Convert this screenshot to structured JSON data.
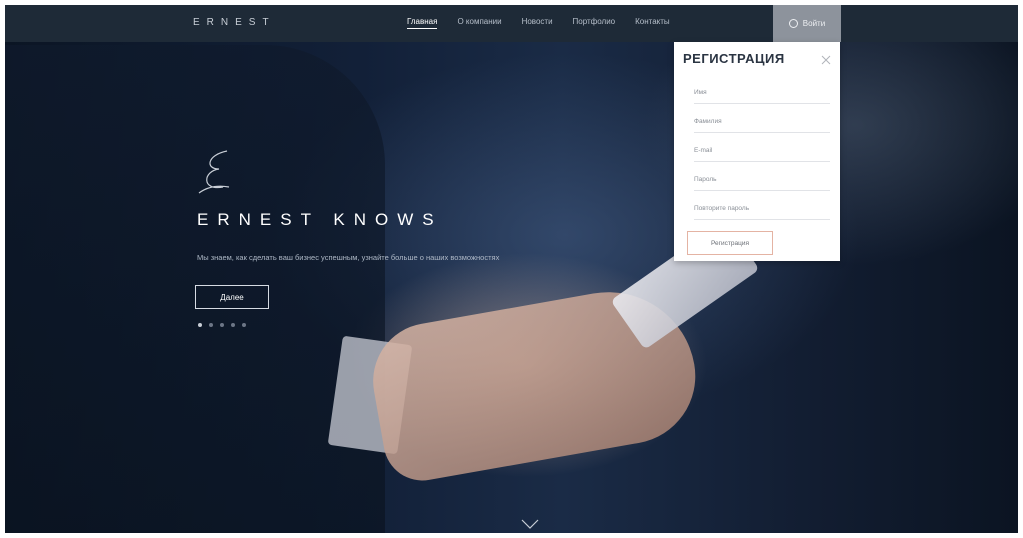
{
  "header": {
    "logo": "ERNEST",
    "nav": [
      "Главная",
      "О компании",
      "Новости",
      "Портфолио",
      "Контакты"
    ],
    "signin_label": "Войти"
  },
  "hero": {
    "title": "ERNEST KNOWS",
    "text": "Мы знаем, как сделать ваш бизнес успешным, узнайте больше о наших возможностях",
    "button_label": "Далее",
    "slides": 5,
    "active_slide": 0
  },
  "registration": {
    "title": "РЕГИСТРАЦИЯ",
    "fields": [
      {
        "placeholder": "Имя"
      },
      {
        "placeholder": "Фамилия"
      },
      {
        "placeholder": "E-mail"
      },
      {
        "placeholder": "Пароль"
      },
      {
        "placeholder": "Повторите пароль"
      }
    ],
    "submit_label": "Регистрация"
  },
  "colors": {
    "navbar": "#1e2a37",
    "signin": "#8d939c",
    "accent_border": "#e4b3a3"
  },
  "icons": [
    "user-icon",
    "close-icon",
    "signature-icon",
    "scroll-down-icon"
  ]
}
